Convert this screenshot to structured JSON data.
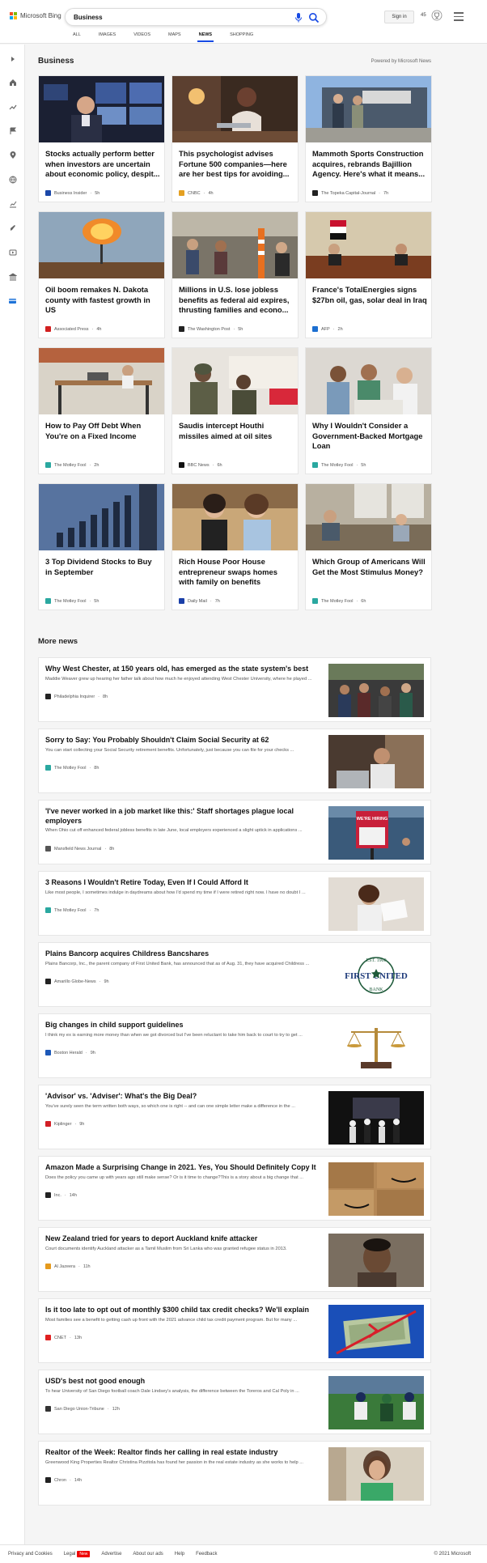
{
  "header": {
    "brand": "Microsoft Bing",
    "query": "Business",
    "signin": "Sign in",
    "points": "45",
    "tabs": [
      "ALL",
      "IMAGES",
      "VIDEOS",
      "MAPS",
      "NEWS",
      "SHOPPING"
    ],
    "active_tab": "NEWS"
  },
  "section": {
    "title": "Business",
    "powered_by": "Powered by Microsoft News"
  },
  "cards": [
    {
      "title": "Stocks actually perform better when investors are uncertain about economic policy, despit...",
      "source": "Business Insider",
      "age": "5h",
      "logo_color": "#1a47a8",
      "icon": "trader-screens-photo"
    },
    {
      "title": "This psychologist advises Fortune 500 companies—here are her best tips for avoiding...",
      "source": "CNBC",
      "age": "4h",
      "logo_color": "#e4a021",
      "icon": "woman-laptop-photo"
    },
    {
      "title": "Mammoth Sports Construction acquires, rebrands Bajillion Agency. Here's what it means...",
      "source": "The Topeka Capital-Journal",
      "age": "7h",
      "logo_color": "#222222",
      "icon": "building-men-photo"
    },
    {
      "title": "Oil boom remakes N. Dakota county with fastest growth in US",
      "source": "Associated Press",
      "age": "4h",
      "logo_color": "#d22020",
      "icon": "gas-flare-photo"
    },
    {
      "title": "Millions in U.S. lose jobless benefits as federal aid expires, thrusting families and econo...",
      "source": "The Washington Post",
      "age": "5h",
      "logo_color": "#222222",
      "icon": "waiting-room-photo"
    },
    {
      "title": "France's TotalEnergies signs $27bn oil, gas, solar deal in Iraq",
      "source": "AFP",
      "age": "2h",
      "logo_color": "#1c6fd1",
      "icon": "signing-photo"
    },
    {
      "title": "How to Pay Off Debt When You're on a Fixed Income",
      "source": "The Motley Fool",
      "age": "2h",
      "logo_color": "#2aa8a0",
      "icon": "desk-photo"
    },
    {
      "title": "Saudis intercept Houthi missiles aimed at oil sites",
      "source": "BBC News",
      "age": "6h",
      "logo_color": "#111111",
      "icon": "soldiers-photo"
    },
    {
      "title": "Why I Wouldn't Consider a Government-Backed Mortgage Loan",
      "source": "The Motley Fool",
      "age": "5h",
      "logo_color": "#2aa8a0",
      "icon": "couple-advisor-photo"
    },
    {
      "title": "3 Top Dividend Stocks to Buy in September",
      "source": "The Motley Fool",
      "age": "5h",
      "logo_color": "#2aa8a0",
      "icon": "bar-chart-photo"
    },
    {
      "title": "Rich House Poor House entrepreneur swaps homes with family on benefits",
      "source": "Daily Mail",
      "age": "7h",
      "logo_color": "#1a3fa8",
      "icon": "two-women-photo"
    },
    {
      "title": "Which Group of Americans Will Get the Most Stimulus Money?",
      "source": "The Motley Fool",
      "age": "6h",
      "logo_color": "#2aa8a0",
      "icon": "family-sofa-photo"
    }
  ],
  "more": {
    "title": "More news",
    "items": [
      {
        "title": "Why West Chester, at 150 years old, has emerged as the state system's best",
        "desc": "Maddie Weaver grew up hearing her father talk about how much he enjoyed attending West Chester University, where he played ...",
        "source": "Philadelphia Inquirer",
        "age": "8h",
        "logo_color": "#222222",
        "icon": "campus-crowd-photo"
      },
      {
        "title": "Sorry to Say: You Probably Shouldn't Claim Social Security at 62",
        "desc": "You can start collecting your Social Security retirement benefits. Unfortunately, just because you can file for your checks ...",
        "source": "The Motley Fool",
        "age": "8h",
        "logo_color": "#2aa8a0",
        "icon": "man-laptop-photo"
      },
      {
        "title": "'I've never worked in a job market like this:' Staff shortages plague local employers",
        "desc": "When Ohio cut off enhanced federal jobless benefits in late June, local employers experienced a slight uptick in applications ...",
        "source": "Mansfield News Journal",
        "age": "8h",
        "logo_color": "#555555",
        "icon": "hiring-sign-photo",
        "sign": "WE'RE HIRING"
      },
      {
        "title": "3 Reasons I Wouldn't Retire Today, Even If I Could Afford It",
        "desc": "Like most people, I sometimes indulge in daydreams about how I'd spend my time if I were retired right now. I have no doubt I ...",
        "source": "The Motley Fool",
        "age": "7h",
        "logo_color": "#2aa8a0",
        "icon": "woman-paper-photo"
      },
      {
        "title": "Plains Bancorp acquires Childress Bancshares",
        "desc": "Plains Bancorp, Inc., the parent company of First United Bank, has announced that as of Aug. 31, they have acquired Childress ...",
        "source": "Amarillo Globe-News",
        "age": "9h",
        "logo_color": "#222222",
        "icon": "bank-logo-image",
        "logo_text": "FIRST UNITED",
        "logo_top": "EST. 1900",
        "logo_bottom": "BANK"
      },
      {
        "title": "Big changes in child support guidelines",
        "desc": "I think my ex is earning more money than when we got divorced but I've been reluctant to take him back to court to try to get ...",
        "source": "Boston Herald",
        "age": "9h",
        "logo_color": "#1c58b8",
        "icon": "scales-photo"
      },
      {
        "title": "'Advisor' vs. 'Adviser': What's the Big Deal?",
        "desc": "You've surely seen the term written both ways, so which one is right -- and can one simple letter make a difference in the ...",
        "source": "Kiplinger",
        "age": "9h",
        "logo_color": "#d21f26",
        "icon": "stage-photo"
      },
      {
        "title": "Amazon Made a Surprising Change in 2021. Yes, You Should Definitely Copy It",
        "desc": "Does the policy you came up with years ago still make sense? Or is it time to change?This is a story about a big change that ...",
        "source": "Inc.",
        "age": "14h",
        "logo_color": "#222222",
        "icon": "boxes-photo"
      },
      {
        "title": "New Zealand tried for years to deport Auckland knife attacker",
        "desc": "Court documents identify Auckland attacker as a Tamil Muslim from Sri Lanka who was granted refugee status in 2013.",
        "source": "Al Jazeera",
        "age": "11h",
        "logo_color": "#e59a1d",
        "icon": "man-portrait-photo"
      },
      {
        "title": "Is it too late to opt out of monthly $300 child tax credit checks? We'll explain",
        "desc": "Most families see a benefit to getting cash up front with the 2021 advance child tax credit payment program. But for many ...",
        "source": "CNET",
        "age": "13h",
        "logo_color": "#e02020",
        "icon": "cash-ribbon-photo"
      },
      {
        "title": "USD's best not good enough",
        "desc": "To hear University of San Diego football coach Dale Lindsey's analysis, the difference between the Toreros and Cal Poly in ...",
        "source": "San Diego Union-Tribune",
        "age": "12h",
        "logo_color": "#333333",
        "icon": "football-photo"
      },
      {
        "title": "Realtor of the Week: Realtor finds her calling in real estate industry",
        "desc": "Greenwood King Properties Realtor Christina Pizzitola has found her passion in the real estate industry as she works to help ...",
        "source": "Chron",
        "age": "14h",
        "logo_color": "#222222",
        "icon": "woman-portrait-photo"
      }
    ]
  },
  "footer": {
    "links": [
      "Privacy and Cookies",
      "Legal",
      "Advertise",
      "About our ads",
      "Help",
      "Feedback"
    ],
    "badge": "New",
    "copyright": "© 2021 Microsoft"
  },
  "colors": {
    "accent": "#174ae4",
    "bing_red": "#f25022",
    "bing_green": "#7fba00",
    "bing_blue": "#00a4ef",
    "bing_yellow": "#ffb900"
  }
}
